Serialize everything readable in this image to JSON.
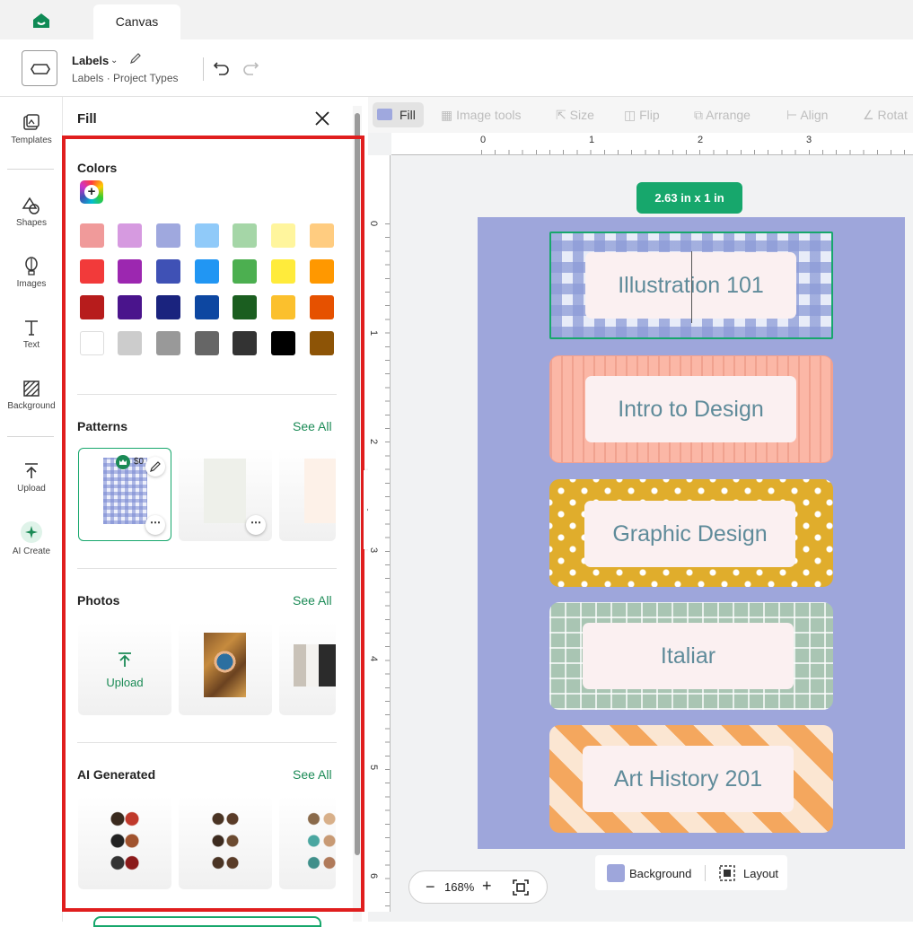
{
  "tabbar": {
    "tab_label": "Canvas"
  },
  "header": {
    "project_title": "Labels",
    "breadcrumb": "Labels  ·  Project Types"
  },
  "rail": {
    "templates": "Templates",
    "shapes": "Shapes",
    "images": "Images",
    "text": "Text",
    "background": "Background",
    "upload": "Upload",
    "ai_create": "AI Create"
  },
  "panel": {
    "title": "Fill",
    "colors_title": "Colors",
    "colors": [
      [
        "#f09a9a",
        "#d69ae0",
        "#9fa8de",
        "#90caf9",
        "#a5d6a7",
        "#fff59d",
        "#ffcc80"
      ],
      [
        "#f23a3a",
        "#9c27b0",
        "#3f51b5",
        "#2196f3",
        "#4caf50",
        "#ffeb3b",
        "#ff9800"
      ],
      [
        "#b71c1c",
        "#4a148c",
        "#1a237e",
        "#0d47a1",
        "#1b5e20",
        "#fbc02d",
        "#e65100"
      ],
      [
        "#ffffff",
        "#cccccc",
        "#999999",
        "#666666",
        "#333333",
        "#000000",
        "#8d5406"
      ]
    ],
    "patterns_title": "Patterns",
    "photos_title": "Photos",
    "ai_title": "AI Generated",
    "see_all": "See All",
    "upload_label": "Upload",
    "price_badge": "$0"
  },
  "toolbar": {
    "fill": "Fill",
    "image_tools": "Image tools",
    "size": "Size",
    "flip": "Flip",
    "arrange": "Arrange",
    "align": "Align",
    "rotate": "Rotat"
  },
  "ruler": {
    "top": [
      "0",
      "1",
      "2",
      "3"
    ],
    "left": [
      "0",
      "1",
      "2",
      "3",
      "4",
      "5",
      "6"
    ]
  },
  "canvas": {
    "size_badge": "2.63  in x 1  in",
    "labels": [
      "Illustration 101",
      "Intro to Design",
      "Graphic Design",
      "Italiar",
      "Art History 201"
    ],
    "artboard_color": "#9ea6db"
  },
  "bottom": {
    "background": "Background",
    "layout": "Layout",
    "zoom": "168%"
  }
}
